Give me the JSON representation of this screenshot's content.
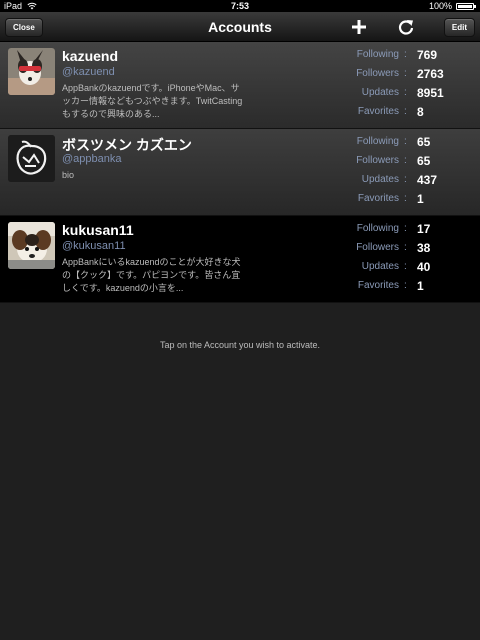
{
  "status_bar": {
    "device": "iPad",
    "time": "7:53",
    "battery": "100%"
  },
  "nav": {
    "close_label": "Close",
    "title": "Accounts",
    "edit_label": "Edit",
    "add_icon": "plus-icon",
    "refresh_icon": "refresh-icon"
  },
  "stat_labels": {
    "following": "Following",
    "followers": "Followers",
    "updates": "Updates",
    "favorites": "Favorites",
    "sep": ":"
  },
  "accounts": [
    {
      "name": "kazuend",
      "handle": "@kazuend",
      "bio": "AppBankのkazuendです。iPhoneやMac、サッカー情報などもつぶやきます。TwitCastingもするので興味のある...",
      "following": "769",
      "followers": "2763",
      "updates": "8951",
      "favorites": "8"
    },
    {
      "name": "ボスツメン カズエン",
      "handle": "@appbanka",
      "bio": "bio",
      "following": "65",
      "followers": "65",
      "updates": "437",
      "favorites": "1"
    },
    {
      "name": "kukusan11",
      "handle": "@kukusan11",
      "bio": "AppBankにいるkazuendのことが大好きな犬の【クック】です。パピヨンです。皆さん宜しくです。kazuendの小言を...",
      "following": "17",
      "followers": "38",
      "updates": "40",
      "favorites": "1"
    }
  ],
  "hint": "Tap on the Account you wish to activate."
}
